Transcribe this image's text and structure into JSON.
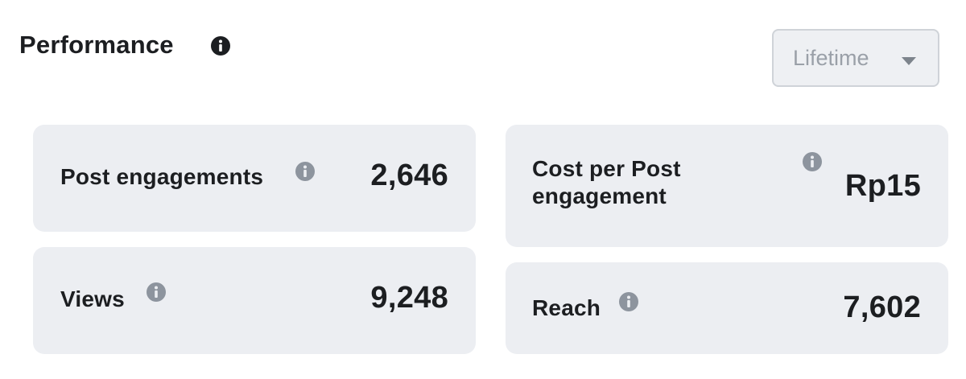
{
  "header": {
    "title": "Performance",
    "info_icon": "info-icon"
  },
  "period_dropdown": {
    "selected": "Lifetime",
    "icon": "caret-down-icon"
  },
  "metrics": [
    {
      "label": "Post engagements",
      "value": "2,646",
      "info_icon": "info-icon"
    },
    {
      "label": "Cost per Post engagement",
      "value": "Rp15",
      "info_icon": "info-icon"
    },
    {
      "label": "Views",
      "value": "9,248",
      "info_icon": "info-icon"
    },
    {
      "label": "Reach",
      "value": "7,602",
      "info_icon": "info-icon"
    }
  ],
  "colors": {
    "card_background": "#eceef2",
    "text": "#1c1e21",
    "info_icon": "#8d949e",
    "dropdown_text": "#9aa0a8"
  }
}
